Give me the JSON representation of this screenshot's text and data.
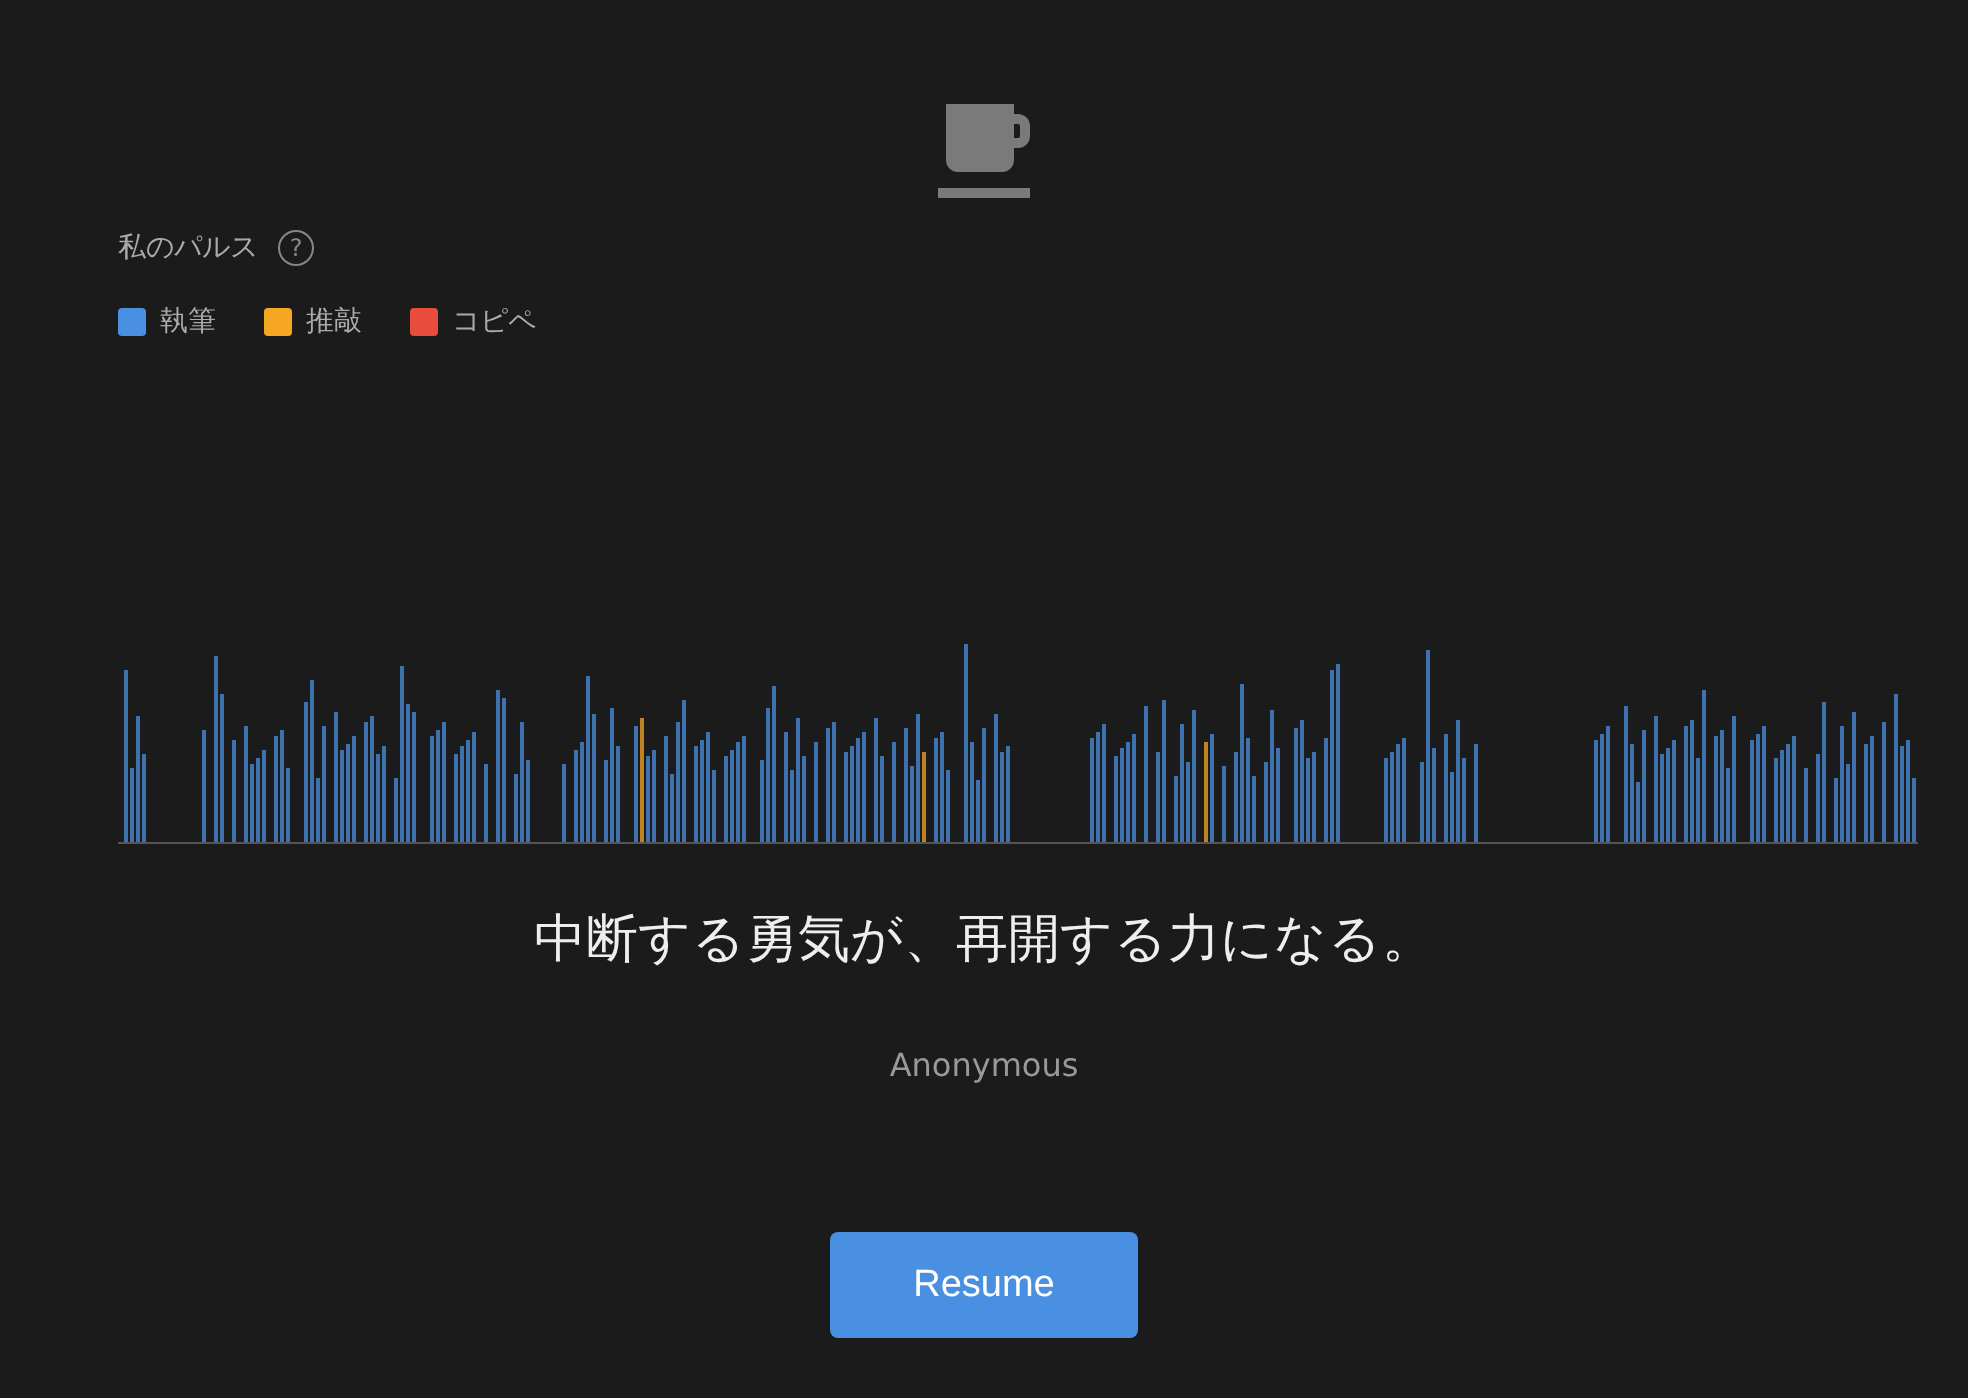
{
  "pulse": {
    "title": "私のパルス",
    "help": "?",
    "legend": [
      {
        "label": "執筆",
        "color": "#4a90e2"
      },
      {
        "label": "推敲",
        "color": "#f5a623"
      },
      {
        "label": "コピペ",
        "color": "#e74c3c"
      }
    ]
  },
  "quote": {
    "text": "中断する勇気が、再開する力になる。",
    "author": "Anonymous"
  },
  "buttons": [
    {
      "label": "Resume"
    }
  ]
}
